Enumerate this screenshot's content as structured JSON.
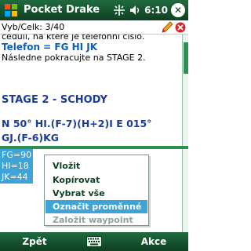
{
  "title_bar": {
    "app_title": "Pocket Drake",
    "clock": "6:10",
    "close_label": "ok",
    "icons": [
      "windows-logo-icon",
      "connectivity-icon",
      "volume-icon"
    ],
    "color": "#1f6b3e"
  },
  "header": {
    "progress": "Vyb/Celk: 3/40",
    "icons": [
      "pencil-icon",
      "cancel-icon"
    ]
  },
  "main_text": {
    "line1": "ceduli, na které je telefonní číslo.",
    "line2": "Telefon = FG HI JK",
    "line3": "Následne pokracujte na STAGE 2.",
    "line4": "STAGE 2 - SCHODY",
    "line5": "N 50° HI.(F-7)(H+2)I E 015°",
    "line6": "GJ.(F-6)KG"
  },
  "variables": {
    "items": [
      "FG=90",
      "HI=18",
      "JK=44"
    ]
  },
  "context_menu": {
    "items": [
      {
        "label": "Vložit",
        "state": "enabled"
      },
      {
        "label": "Kopírovat",
        "state": "enabled"
      },
      {
        "label": "Vybrat vše",
        "state": "enabled"
      },
      {
        "label": "Označit proměnné",
        "state": "selected"
      },
      {
        "label": "Založit waypoint",
        "state": "disabled"
      }
    ],
    "highlight_color": "#3ea3d6"
  },
  "softkeys": {
    "left": "Zpět",
    "right": "Akce",
    "center_icon": "keyboard-icon"
  }
}
